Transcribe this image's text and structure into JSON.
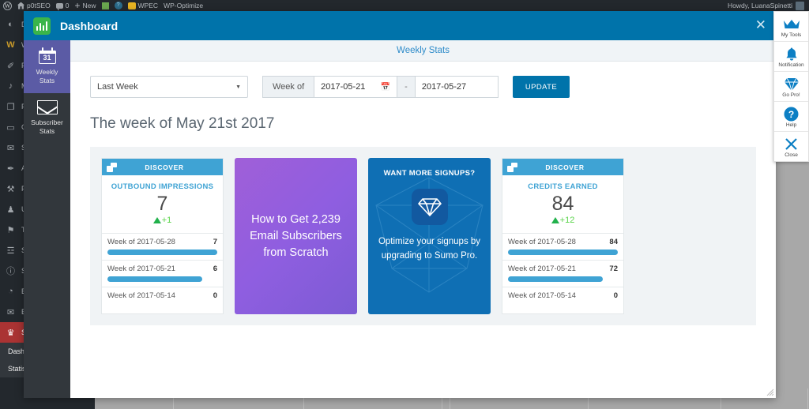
{
  "wp_adminbar": {
    "site_name": "p0tSEO",
    "comment_count": "0",
    "new_label": "New",
    "help_label": "?",
    "plugin1": "WPEC",
    "plugin2": "WP-Optimize",
    "howdy": "Howdy, LuanaSpinetti"
  },
  "wp_sidebar": {
    "items": [
      {
        "icon": "dashboard-icon",
        "glyph": "◔",
        "label": "D"
      },
      {
        "icon": "woocommerce-icon",
        "glyph": "W",
        "label": "W"
      },
      {
        "icon": "pin-icon",
        "glyph": "✐",
        "label": "P"
      },
      {
        "icon": "media-icon",
        "glyph": "♫",
        "label": "M"
      },
      {
        "icon": "pages-icon",
        "glyph": "❐",
        "label": "P"
      },
      {
        "icon": "comments-icon",
        "glyph": "▭",
        "label": "C"
      },
      {
        "icon": "mail-icon",
        "glyph": "✉",
        "label": "S"
      },
      {
        "icon": "appearance-icon",
        "glyph": "✎",
        "label": "A"
      },
      {
        "icon": "plugins-icon",
        "glyph": "⚒",
        "label": "P"
      },
      {
        "icon": "users-icon",
        "glyph": "♟",
        "label": "U"
      },
      {
        "icon": "tools-icon",
        "glyph": "⚒",
        "label": "T"
      },
      {
        "icon": "settings-icon",
        "glyph": "☲",
        "label": "S"
      },
      {
        "icon": "yoast-icon",
        "glyph": "ⓨ",
        "label": "S"
      },
      {
        "icon": "speed-icon",
        "glyph": "◔",
        "label": "E"
      },
      {
        "icon": "twitter-icon",
        "glyph": "✉",
        "label": "E"
      }
    ],
    "highlight_item": {
      "icon": "crown-icon",
      "glyph": "♛",
      "label": "S"
    },
    "submenu": [
      "Dashboard",
      "Statistics"
    ]
  },
  "modal": {
    "title": "Dashboard",
    "close_label": "✕",
    "subheader": "Weekly Stats",
    "nav": [
      {
        "label_line1": "Weekly",
        "label_line2": "Stats",
        "icon": "calendar-icon",
        "day": "31",
        "active": true
      },
      {
        "label_line1": "Subscriber",
        "label_line2": "Stats",
        "icon": "envelope-icon",
        "active": false
      }
    ],
    "toolbar": {
      "range_selected": "Last Week",
      "week_of_label": "Week of",
      "start_date": "2017-05-21",
      "end_date": "2017-05-27",
      "separator": "-",
      "update_label": "UPDATE",
      "calendar_icon": "calendar-icon"
    },
    "week_title": "The week of May 21st 2017",
    "cards": [
      {
        "type": "stat",
        "header": "DISCOVER",
        "header_icon": "discover-icon",
        "title": "OUTBOUND IMPRESSIONS",
        "value": "7",
        "delta": "+1",
        "delta_direction": "up",
        "rows": [
          {
            "label": "Week of 2017-05-28",
            "value": "7",
            "bar_pct": 100
          },
          {
            "label": "Week of 2017-05-21",
            "value": "6",
            "bar_pct": 86
          },
          {
            "label": "Week of 2017-05-14",
            "value": "0",
            "bar_pct": 0
          }
        ]
      },
      {
        "type": "promo_purple",
        "text": "How to Get 2,239 Email Subscribers from Scratch"
      },
      {
        "type": "promo_blue",
        "title": "WANT MORE SIGNUPS?",
        "icon": "diamond-icon",
        "description": "Optimize your signups by upgrading to Sumo Pro."
      },
      {
        "type": "stat",
        "header": "DISCOVER",
        "header_icon": "discover-icon",
        "title": "CREDITS EARNED",
        "value": "84",
        "delta": "+12",
        "delta_direction": "up",
        "rows": [
          {
            "label": "Week of 2017-05-28",
            "value": "84",
            "bar_pct": 100
          },
          {
            "label": "Week of 2017-05-21",
            "value": "72",
            "bar_pct": 86
          },
          {
            "label": "Week of 2017-05-14",
            "value": "0",
            "bar_pct": 0
          }
        ]
      }
    ]
  },
  "right_toolbar": [
    {
      "label": "My Tools",
      "icon": "crown-icon"
    },
    {
      "label": "Notification",
      "icon": "bell-icon"
    },
    {
      "label": "Go Pro!",
      "icon": "diamond-icon"
    },
    {
      "label": "Help",
      "icon": "question-circle-icon"
    },
    {
      "label": "Close",
      "icon": "close-icon"
    }
  ],
  "colors": {
    "modal_header": "#0073aa",
    "accent_blue": "#3fa3d4",
    "active_nav": "#5b5ba5",
    "promo_purple": "#8f5ee0",
    "promo_blue": "#0f6fb4",
    "delta_green": "#5ad44a"
  }
}
